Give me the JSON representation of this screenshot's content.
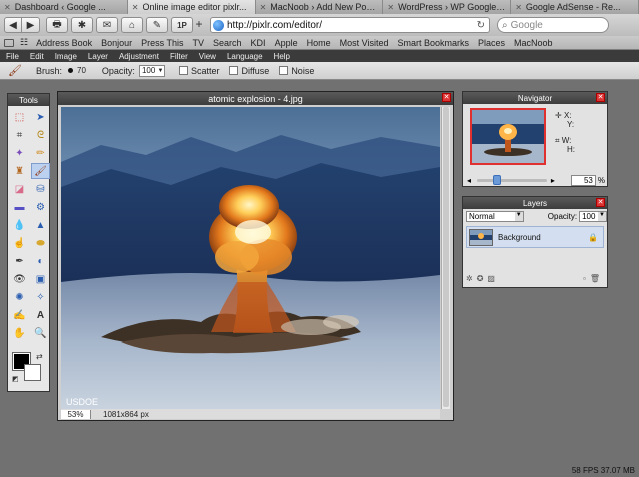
{
  "browser": {
    "tabs": [
      {
        "title": "Dashboard ‹ Google ...",
        "active": false
      },
      {
        "title": "Online image editor pixlr...",
        "active": true
      },
      {
        "title": "MacNoob › Add New Post...",
        "active": false
      },
      {
        "title": "WordPress › WP Google A...",
        "active": false
      },
      {
        "title": "Google AdSense - Re...",
        "active": false
      }
    ],
    "close_glyph": "✕",
    "url": "http://pixlr.com/editor/",
    "search_placeholder": "Google",
    "bookmarks": [
      "Address Book",
      "Bonjour",
      "Press This",
      "TV",
      "Search",
      "KDI",
      "Apple",
      "Home",
      "Most Visited",
      "Smart Bookmarks",
      "Places",
      "MacNoob"
    ],
    "toolbar_icons": [
      "back-icon",
      "forward-icon",
      "print-icon",
      "settings-icon",
      "mail-icon",
      "home-icon",
      "edit-icon",
      "1password-icon",
      "new-tab-icon"
    ],
    "onepassword_label": "1P"
  },
  "app": {
    "menu": [
      "File",
      "Edit",
      "Image",
      "Layer",
      "Adjustment",
      "Filter",
      "View",
      "Language",
      "Help"
    ],
    "options": {
      "brush_label": "Brush:",
      "brush_size": "70",
      "opacity_label": "Opacity:",
      "opacity_value": "100",
      "checkboxes": [
        "Scatter",
        "Diffuse",
        "Noise"
      ]
    },
    "tools_panel": {
      "title": "Tools",
      "tools": [
        "marquee-tool-icon",
        "move-tool-icon",
        "crop-tool-icon",
        "lasso-tool-icon",
        "wand-tool-icon",
        "pencil-tool-icon",
        "stamp-tool-icon",
        "brush-tool-icon",
        "eraser-tool-icon",
        "paint-bucket-tool-icon",
        "gradient-tool-icon",
        "clone-stamp-tool-icon",
        "blur-tool-icon",
        "sharpen-tool-icon",
        "smudge-tool-icon",
        "sponge-tool-icon",
        "dodge-tool-icon",
        "burn-tool-icon",
        "red-eye-tool-icon",
        "spot-heal-tool-icon",
        "bloat-tool-icon",
        "pinch-tool-icon",
        "color-picker-tool-icon",
        "text-tool-icon",
        "hand-tool-icon",
        "zoom-tool-icon"
      ],
      "foreground_color": "#000000",
      "background_color": "#ffffff"
    },
    "image_window": {
      "title": "atomic explosion - 4.jpg",
      "watermark": "USDOE",
      "zoom": "53",
      "zoom_suffix": "%",
      "dimensions": "1081x864 px"
    },
    "navigator": {
      "title": "Navigator",
      "x_label": "X:",
      "y_label": "Y:",
      "w_label": "W:",
      "h_label": "H:",
      "zoom": "53",
      "percent": "%"
    },
    "layers": {
      "title": "Layers",
      "blend_mode": "Normal",
      "opacity_label": "Opacity:",
      "opacity_value": "100",
      "items": [
        {
          "name": "Background",
          "locked": true
        }
      ]
    },
    "footer": {
      "fps": "58 FPS 37.07 MB"
    }
  },
  "colors": {
    "accent_red": "#d33333",
    "panel_dark": "#3d3d3d",
    "selection_blue": "#d3dff0"
  }
}
